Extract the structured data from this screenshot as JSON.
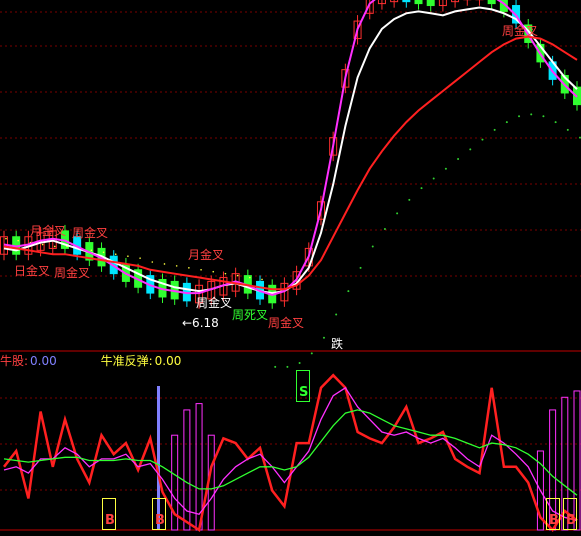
{
  "colors": {
    "background": "#000000",
    "grid": "#7a0000",
    "up": "#ff3030",
    "down": "#30ff30",
    "cyan": "#00e5ff",
    "white": "#ffffff",
    "magenta": "#ff30ff",
    "red_ma": "#ff2020",
    "yellow": "#ffff40",
    "green_dots": "#30d030",
    "blue_bar": "#8080ff",
    "label_red": "#ff4040",
    "label_yellow": "#ffff80"
  },
  "upper_panel": {
    "signal_labels": [
      {
        "text": "月金叉",
        "color": "red"
      },
      {
        "text": "周金叉",
        "color": "red"
      },
      {
        "text": "周金叉",
        "color": "red"
      },
      {
        "text": "日金叉",
        "color": "red"
      },
      {
        "text": "月金叉",
        "color": "red"
      },
      {
        "text": "周金叉",
        "color": "white"
      },
      {
        "text": "周死叉",
        "color": "green"
      },
      {
        "text": "周金叉",
        "color": "red"
      },
      {
        "text": "周金叉",
        "color": "red"
      }
    ],
    "low_price_label": "←6.18",
    "bottom_label": "跌"
  },
  "lower_panel": {
    "indicator_1": {
      "label": "牛股:",
      "value": "0.00"
    },
    "indicator_2": {
      "label": "牛准反弹:",
      "value": "0.00"
    },
    "signals": [
      {
        "text": "B"
      },
      {
        "text": "B"
      },
      {
        "text": "S"
      },
      {
        "text": "B"
      },
      {
        "text": "B"
      }
    ]
  },
  "chart_data": [
    {
      "type": "line",
      "title": "",
      "series": [
        {
          "name": "",
          "color": "white",
          "values": [
            12.2,
            12.1,
            12.3,
            12.5,
            12.6,
            12.4,
            12.2,
            12.0,
            11.8,
            11.5,
            11.2,
            10.9,
            10.6,
            10.4,
            10.2,
            10.1,
            10.0,
            10.1,
            10.3,
            10.4,
            10.2,
            10.0,
            9.9,
            10.0,
            10.4,
            11.2,
            13.0,
            15.5,
            18.5,
            21.0,
            22.5,
            23.5,
            24.0,
            24.3,
            24.4,
            24.3,
            24.2,
            24.4,
            24.5,
            24.6,
            24.5,
            24.3,
            24.0,
            23.4,
            22.6,
            21.8,
            21.0,
            20.4
          ]
        },
        {
          "name": "",
          "color": "magenta",
          "values": [
            12.4,
            12.3,
            12.4,
            12.6,
            12.7,
            12.6,
            12.3,
            12.0,
            11.7,
            11.3,
            10.9,
            10.6,
            10.3,
            10.1,
            10.0,
            9.9,
            9.9,
            10.1,
            10.3,
            10.5,
            10.3,
            10.0,
            9.8,
            10.0,
            10.6,
            11.8,
            14.2,
            17.5,
            21.0,
            23.5,
            24.8,
            25.3,
            25.4,
            25.3,
            25.2,
            25.1,
            25.2,
            25.4,
            25.5,
            25.5,
            25.2,
            24.8,
            24.2,
            23.2,
            22.2,
            21.3,
            20.6,
            20.0
          ]
        },
        {
          "name": "",
          "color": "red",
          "values": [
            12.3,
            12.2,
            12.1,
            12.0,
            11.9,
            11.9,
            11.8,
            11.7,
            11.6,
            11.5,
            11.4,
            11.3,
            11.1,
            11.0,
            10.9,
            10.8,
            10.7,
            10.6,
            10.5,
            10.4,
            10.3,
            10.2,
            10.1,
            10.1,
            10.3,
            10.8,
            11.6,
            12.8,
            14.0,
            15.2,
            16.3,
            17.2,
            18.0,
            18.7,
            19.3,
            19.8,
            20.3,
            20.8,
            21.3,
            21.8,
            22.3,
            22.7,
            23.0,
            23.1,
            23.0,
            22.7,
            22.3,
            21.9
          ]
        }
      ]
    },
    {
      "type": "line",
      "title": "",
      "series": [
        {
          "name": "",
          "color": "red",
          "values": [
            40,
            50,
            20,
            75,
            40,
            70,
            45,
            30,
            60,
            48,
            55,
            38,
            58,
            24,
            10,
            5,
            0,
            40,
            58,
            55,
            45,
            52,
            25,
            15,
            55,
            55,
            90,
            98,
            90,
            62,
            58,
            55,
            65,
            78,
            55,
            58,
            62,
            45,
            40,
            36,
            90,
            40,
            40,
            30,
            8,
            0,
            12,
            6
          ]
        },
        {
          "name": "",
          "color": "magenta",
          "values": [
            38,
            40,
            36,
            45,
            45,
            52,
            48,
            40,
            45,
            45,
            48,
            40,
            42,
            32,
            20,
            12,
            10,
            20,
            32,
            40,
            45,
            48,
            40,
            30,
            40,
            50,
            70,
            85,
            90,
            78,
            70,
            62,
            60,
            62,
            58,
            55,
            58,
            52,
            45,
            40,
            60,
            55,
            48,
            40,
            25,
            12,
            8,
            6
          ]
        },
        {
          "name": "",
          "color": "green",
          "values": [
            45,
            44,
            43,
            44,
            45,
            46,
            46,
            44,
            44,
            44,
            45,
            44,
            44,
            40,
            35,
            30,
            26,
            26,
            28,
            32,
            36,
            40,
            40,
            38,
            40,
            46,
            56,
            66,
            74,
            76,
            74,
            70,
            66,
            64,
            62,
            60,
            60,
            58,
            55,
            52,
            55,
            54,
            52,
            48,
            42,
            34,
            28,
            22
          ]
        }
      ]
    }
  ]
}
